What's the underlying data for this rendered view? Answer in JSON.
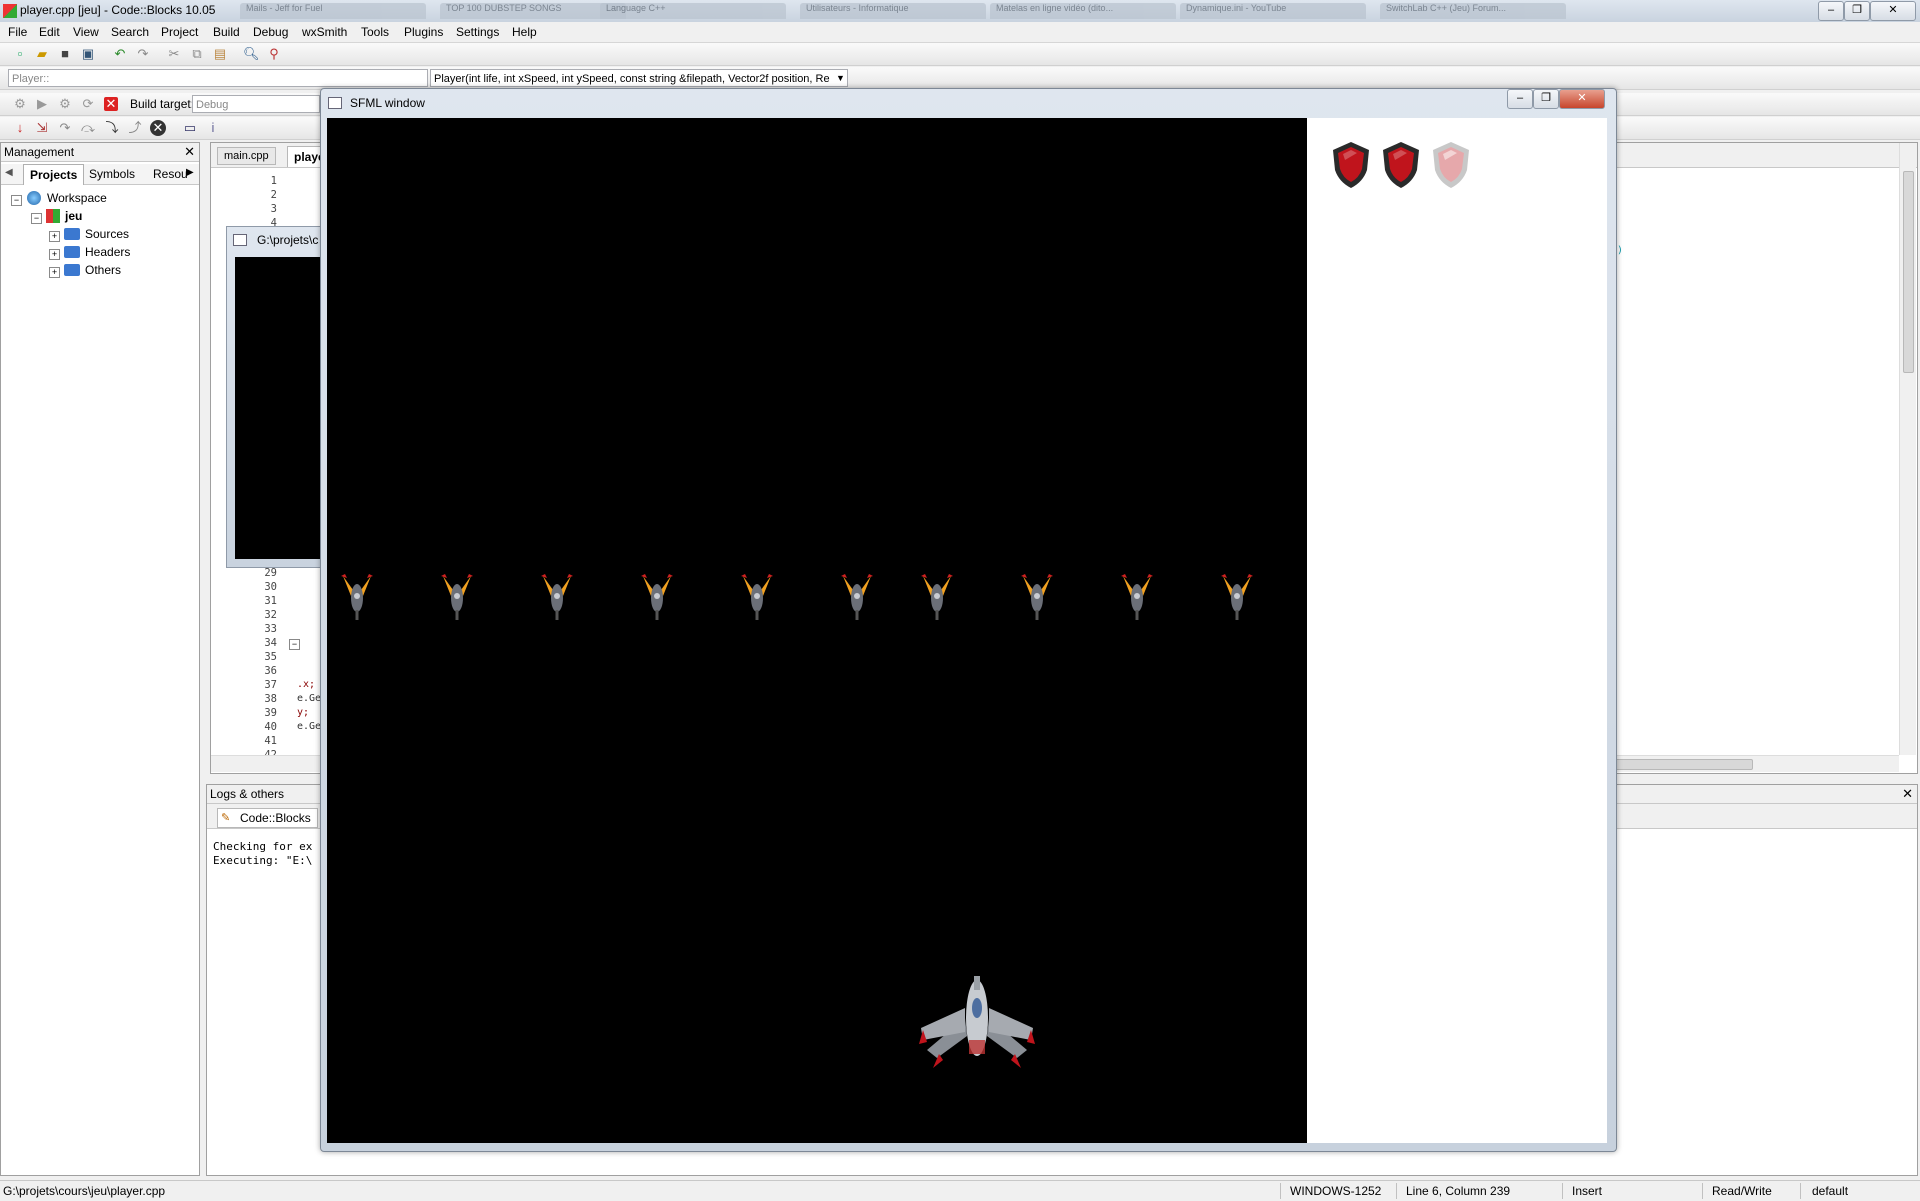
{
  "window": {
    "title": "player.cpp [jeu] - Code::Blocks 10.05",
    "ghost_tabs": [
      "Mails - Jeff for Fuel",
      "TOP 100 DUBSTEP SONGS",
      "Language C++",
      "Utilisateurs - Informatique",
      "Matelas en ligne vidéo (dito...",
      "Dynamique.ini - YouTube",
      "SwitchLab C++ (Jeu) Forum..."
    ]
  },
  "menubar": [
    "File",
    "Edit",
    "View",
    "Search",
    "Project",
    "Build",
    "Debug",
    "wxSmith",
    "Tools",
    "Plugins",
    "Settings",
    "Help"
  ],
  "toolbar": {
    "scope_combo": "Player::",
    "function_combo": "Player(int life, int xSpeed, int ySpeed, const string &filepath, Vector2f position, Re",
    "build_target_label": "Build target:",
    "build_target_value": "Debug"
  },
  "management": {
    "title": "Management",
    "tabs": [
      "Projects",
      "Symbols",
      "Resou"
    ],
    "tree": {
      "workspace": "Workspace",
      "project": "jeu",
      "folders": [
        "Sources",
        "Headers",
        "Others"
      ]
    }
  },
  "editor": {
    "tabs": [
      "main.cpp",
      "playe"
    ],
    "line_numbers_top": [
      "1",
      "2",
      "3",
      "4"
    ],
    "line_numbers_bottom": [
      "29",
      "30",
      "31",
      "32",
      "33",
      "34",
      "35",
      "36",
      "37",
      "38",
      "39",
      "40",
      "41",
      "42"
    ],
    "code_fragments": [
      ".x;",
      "e.Ge",
      "y;",
      "e.Ge"
    ],
    "right_fragment": "3)"
  },
  "logs": {
    "title": "Logs & others",
    "tab": "Code::Blocks",
    "lines": [
      "Checking for ex",
      "Executing: \"E:\\"
    ]
  },
  "console": {
    "title": "G:\\projets\\c"
  },
  "sfml": {
    "title": "SFML window",
    "shields": {
      "total": 3,
      "active": 2
    },
    "enemy_count": 10
  },
  "statusbar": {
    "path": "G:\\projets\\cours\\jeu\\player.cpp",
    "encoding": "WINDOWS-1252",
    "position": "Line 6, Column 239",
    "mode": "Insert",
    "access": "Read/Write",
    "profile": "default"
  },
  "colors": {
    "shield": "#c0141c",
    "shield_inactive": "#e6a8ab",
    "enemy_body": "#6b6f78",
    "flame": "#f0a020"
  }
}
